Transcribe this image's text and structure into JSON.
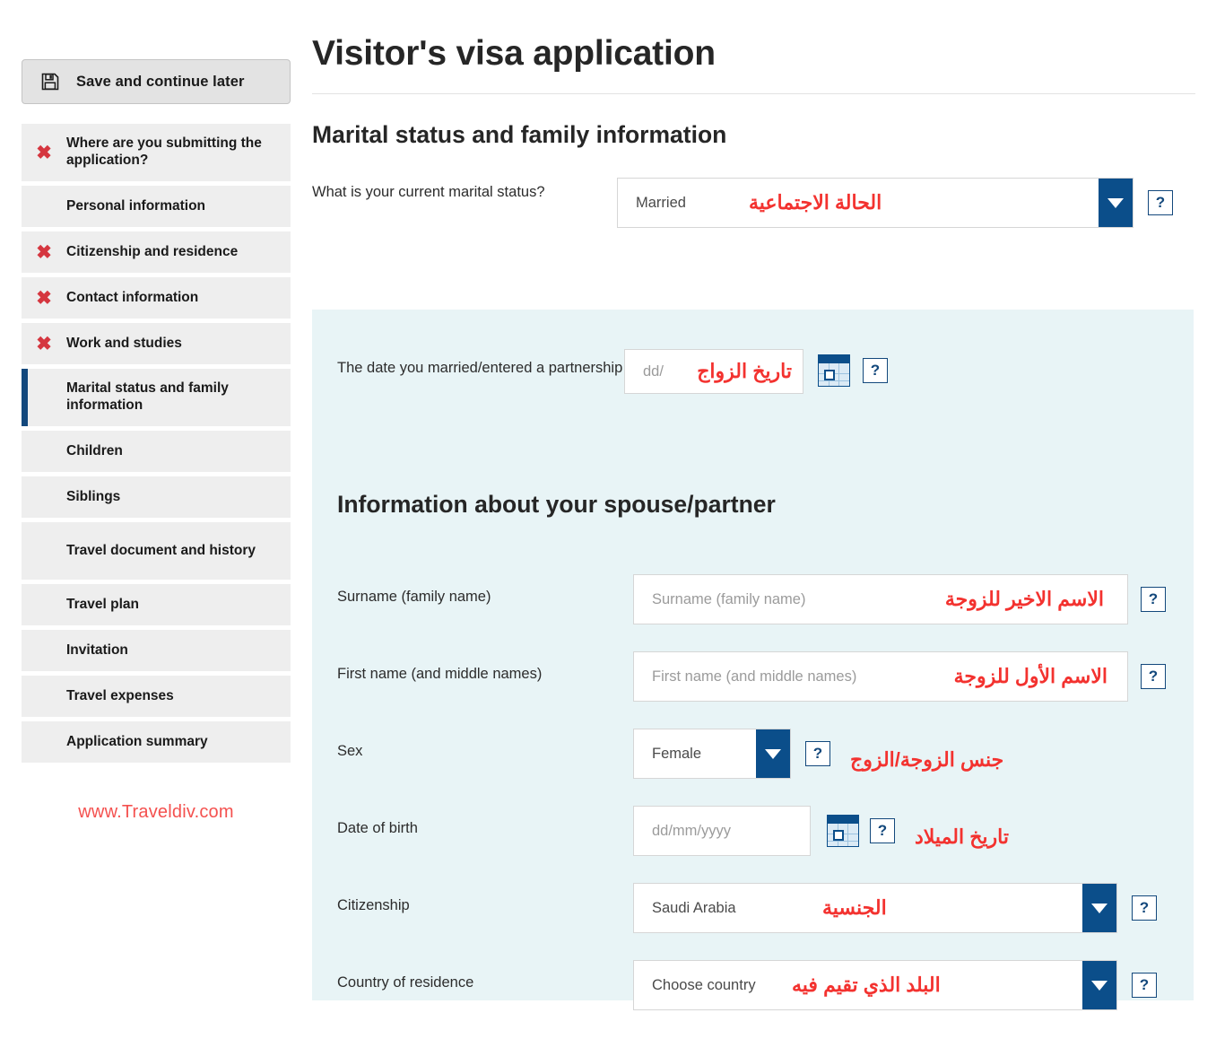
{
  "sidebar": {
    "save_button": "Save and continue later",
    "save_icon": "floppy-disk-icon",
    "items": [
      {
        "label": "Where are you submitting the application?",
        "error": true,
        "active": false,
        "tall": true
      },
      {
        "label": "Personal information",
        "error": false,
        "active": false,
        "tall": false
      },
      {
        "label": "Citizenship and residence",
        "error": true,
        "active": false,
        "tall": false
      },
      {
        "label": "Contact information",
        "error": true,
        "active": false,
        "tall": false
      },
      {
        "label": "Work and studies",
        "error": true,
        "active": false,
        "tall": false
      },
      {
        "label": "Marital status and family information",
        "error": false,
        "active": true,
        "tall": true
      },
      {
        "label": "Children",
        "error": false,
        "active": false,
        "tall": false
      },
      {
        "label": "Siblings",
        "error": false,
        "active": false,
        "tall": false
      },
      {
        "label": "Travel document and history",
        "error": false,
        "active": false,
        "tall": true
      },
      {
        "label": "Travel plan",
        "error": false,
        "active": false,
        "tall": false
      },
      {
        "label": "Invitation",
        "error": false,
        "active": false,
        "tall": false
      },
      {
        "label": "Travel expenses",
        "error": false,
        "active": false,
        "tall": false
      },
      {
        "label": "Application summary",
        "error": false,
        "active": false,
        "tall": false
      }
    ],
    "watermark": "www.Traveldiv.com",
    "error_mark": "✖"
  },
  "main": {
    "page_title": "Visitor's visa application",
    "section_title": "Marital status and family information",
    "panel_heading": "Information about your spouse/partner",
    "help_label": "?",
    "marital_status": {
      "label": "What is your current marital status?",
      "value": "Married",
      "annotation_ar": "الحالة الاجتماعية"
    },
    "marriage_date": {
      "label": "The date you married/entered a partnership",
      "placeholder": "dd/",
      "annotation_ar": "تاريخ الزواج"
    },
    "surname": {
      "label": "Surname (family name)",
      "placeholder": "Surname (family name)",
      "annotation_ar": "الاسم الاخير للزوجة"
    },
    "first_name": {
      "label": "First name (and middle names)",
      "placeholder": "First name (and middle names)",
      "annotation_ar": "الاسم الأول للزوجة"
    },
    "sex": {
      "label": "Sex",
      "value": "Female",
      "annotation_ar": "جنس الزوجة/الزوج"
    },
    "date_of_birth": {
      "label": "Date of birth",
      "placeholder": "dd/mm/yyyy",
      "annotation_ar": "تاريخ الميلاد"
    },
    "citizenship": {
      "label": "Citizenship",
      "value": "Saudi Arabia",
      "annotation_ar": "الجنسية"
    },
    "country_of_residence": {
      "label": "Country of residence",
      "value": "Choose country",
      "annotation_ar": "البلد الذي تقيم فيه"
    }
  },
  "colors": {
    "accent_blue": "#0b4e8a",
    "active_bar": "#13487c",
    "error_red": "#d5363f",
    "annotation_red": "#f3322f",
    "panel_bg": "#e8f4f6",
    "nav_bg": "#eeeeee"
  }
}
